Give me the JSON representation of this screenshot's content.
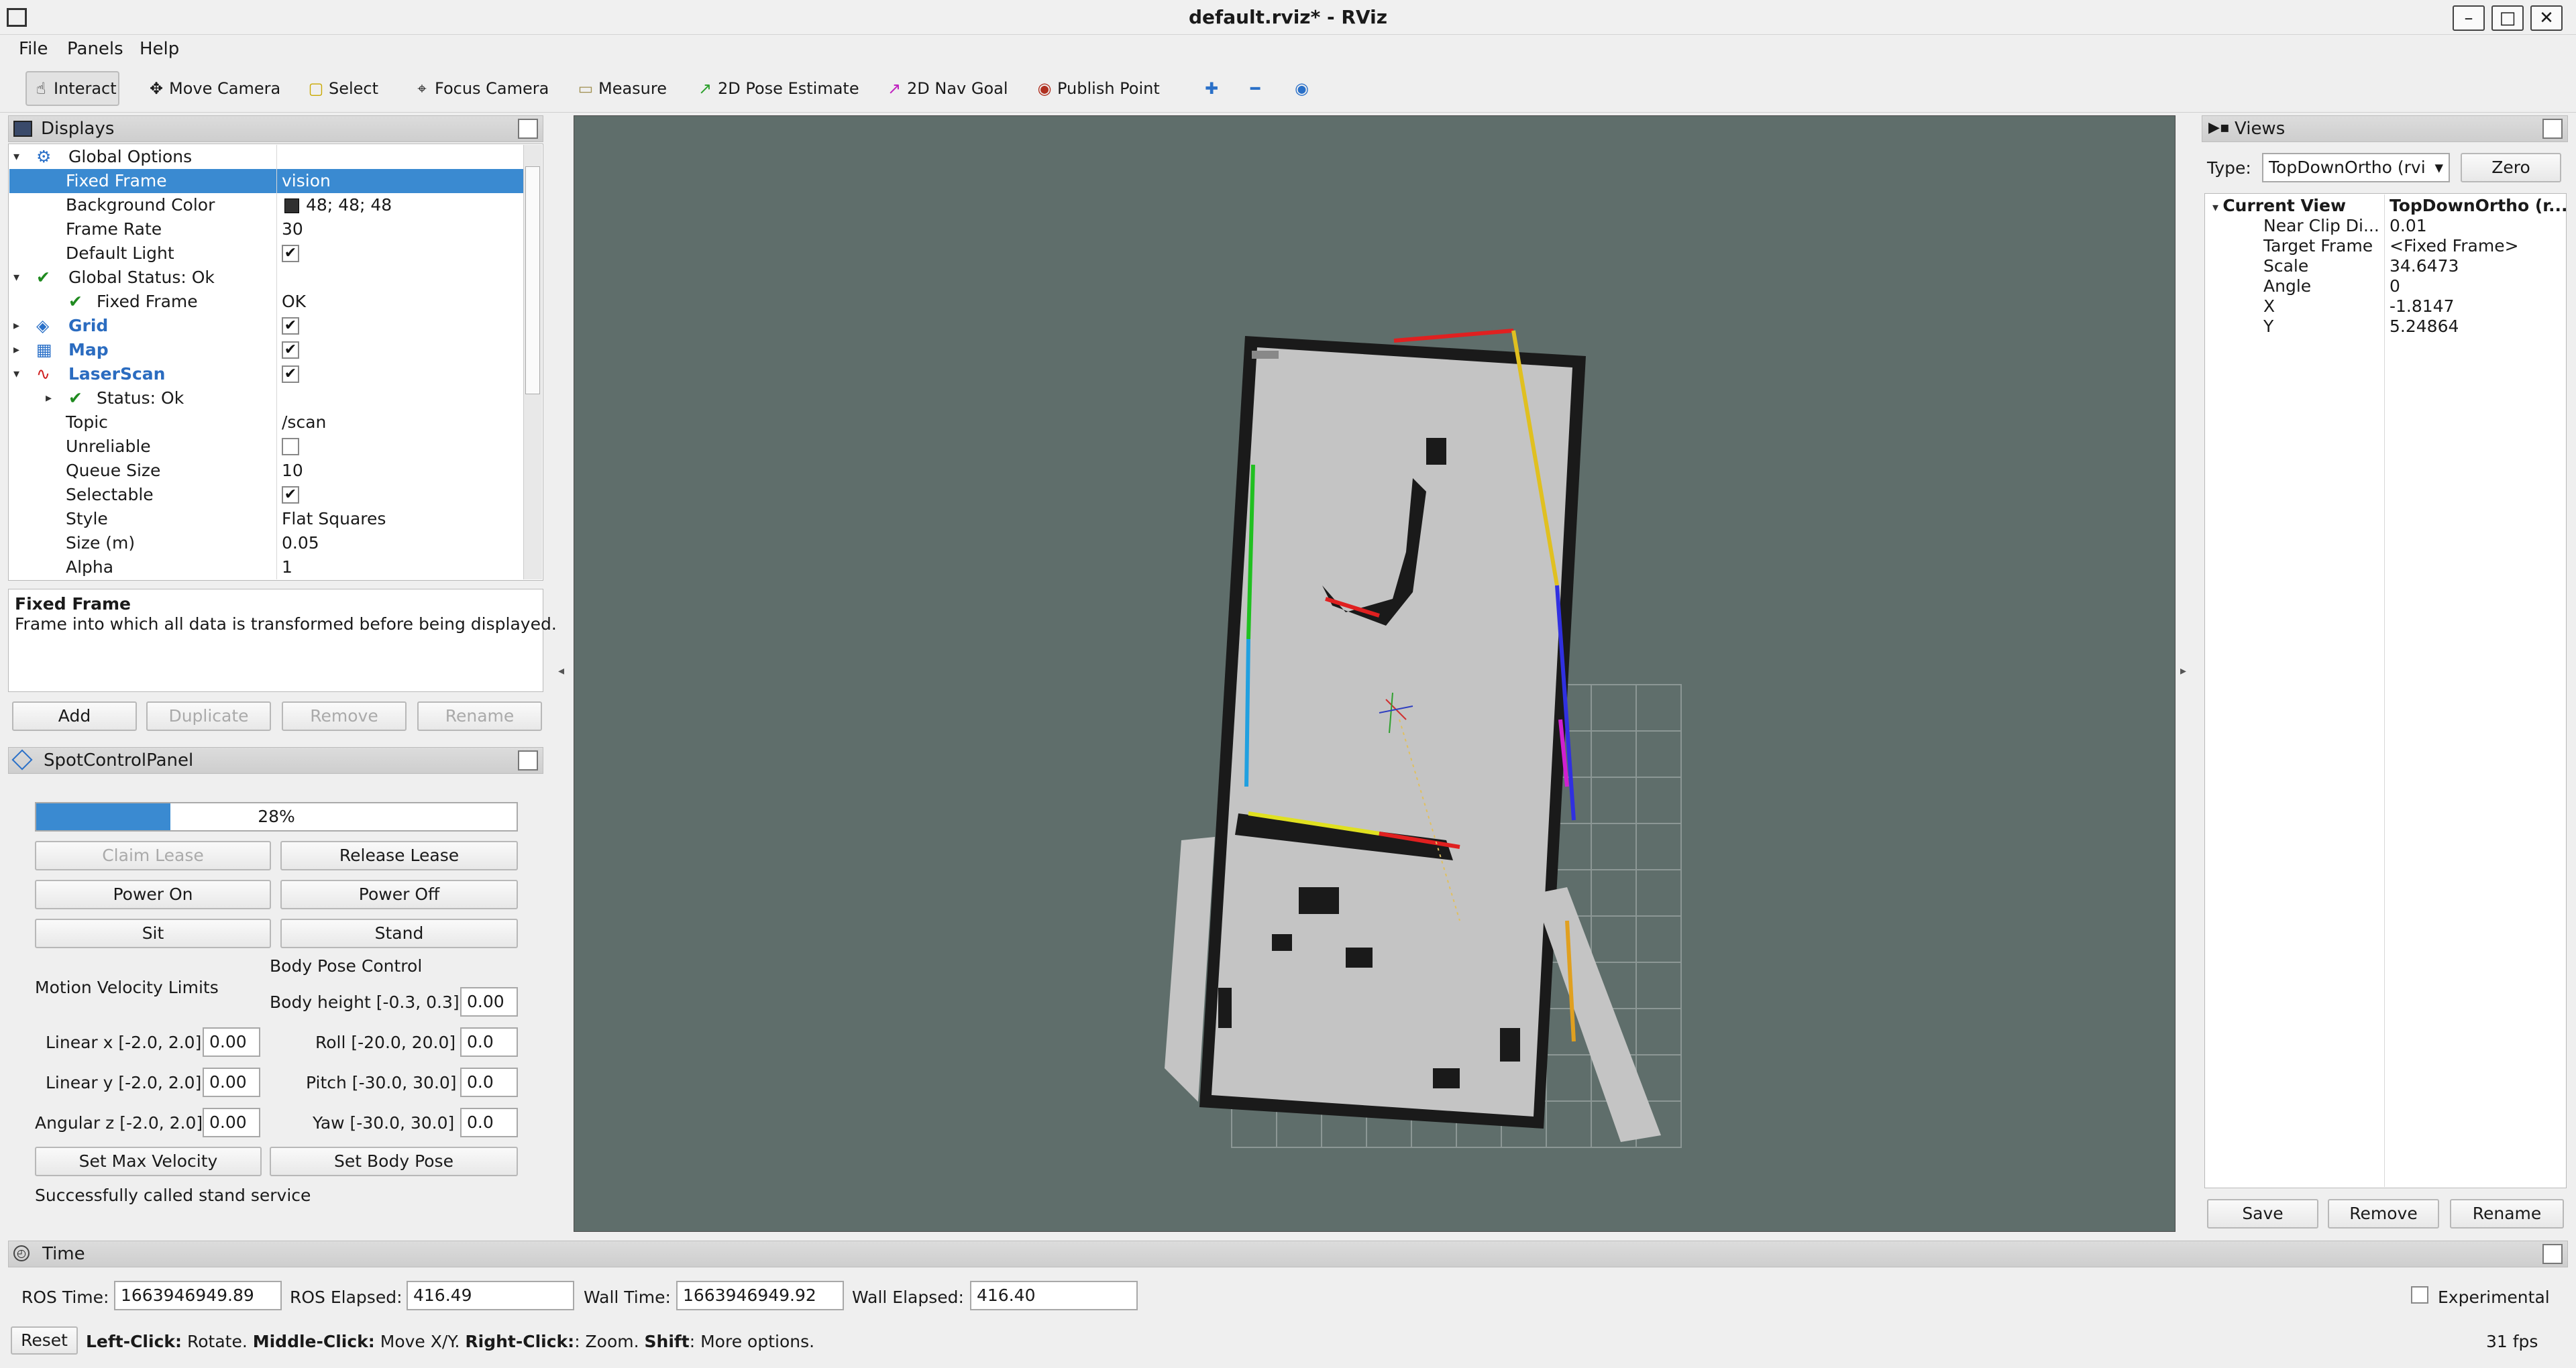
{
  "window": {
    "title": "default.rviz* - RViz",
    "min_glyph": "–",
    "max_glyph": "□",
    "close_glyph": "✕"
  },
  "menu": [
    "File",
    "Panels",
    "Help"
  ],
  "toolbar": [
    {
      "label": "Interact",
      "icon": "hand-icon",
      "glyph": "☝"
    },
    {
      "label": "Move Camera",
      "icon": "move-camera-icon",
      "glyph": "✥"
    },
    {
      "label": "Select",
      "icon": "select-icon",
      "glyph": "▢"
    },
    {
      "label": "Focus Camera",
      "icon": "focus-camera-icon",
      "glyph": "⌖"
    },
    {
      "label": "Measure",
      "icon": "ruler-icon",
      "glyph": "▭"
    },
    {
      "label": "2D Pose Estimate",
      "icon": "pose-estimate-icon",
      "glyph": "↗"
    },
    {
      "label": "2D Nav Goal",
      "icon": "nav-goal-icon",
      "glyph": "↗"
    },
    {
      "label": "Publish Point",
      "icon": "map-pin-icon",
      "glyph": "◉"
    }
  ],
  "toolbar_extra": {
    "plus": "✚",
    "minus": "━",
    "eye": "◉"
  },
  "displays": {
    "title": "Displays",
    "rows": [
      {
        "label": "Global Options",
        "value": "",
        "indent": 0,
        "expand": "▾",
        "icon": "⚙"
      },
      {
        "label": "Fixed Frame",
        "value": "vision",
        "indent": 1,
        "selected": true
      },
      {
        "label": "Background Color",
        "value": "48; 48; 48",
        "indent": 1,
        "swatch": "#303030"
      },
      {
        "label": "Frame Rate",
        "value": "30",
        "indent": 1
      },
      {
        "label": "Default Light",
        "value": "✔",
        "indent": 1,
        "check": true
      },
      {
        "label": "Global Status: Ok",
        "value": "",
        "indent": 0,
        "expand": "▾",
        "icon": "✔",
        "iconColor": "#1f8a1f"
      },
      {
        "label": "Fixed Frame",
        "value": "OK",
        "indent": 1,
        "icon": "✔",
        "iconColor": "#1f8a1f"
      },
      {
        "label": "Grid",
        "value": "✔",
        "indent": 0,
        "expand": "▸",
        "icon": "◈",
        "link": true,
        "check": true
      },
      {
        "label": "Map",
        "value": "✔",
        "indent": 0,
        "expand": "▸",
        "icon": "▦",
        "link": true,
        "check": true
      },
      {
        "label": "LaserScan",
        "value": "✔",
        "indent": 0,
        "expand": "▾",
        "icon": "∿",
        "iconColor": "#d02020",
        "link": true,
        "check": true
      },
      {
        "label": "Status: Ok",
        "value": "",
        "indent": 1,
        "expand": "▸",
        "icon": "✔",
        "iconColor": "#1f8a1f"
      },
      {
        "label": "Topic",
        "value": "/scan",
        "indent": 1
      },
      {
        "label": "Unreliable",
        "value": "",
        "indent": 1,
        "check": true
      },
      {
        "label": "Queue Size",
        "value": "10",
        "indent": 1
      },
      {
        "label": "Selectable",
        "value": "✔",
        "indent": 1,
        "check": true
      },
      {
        "label": "Style",
        "value": "Flat Squares",
        "indent": 1
      },
      {
        "label": "Size (m)",
        "value": "0.05",
        "indent": 1
      },
      {
        "label": "Alpha",
        "value": "1",
        "indent": 1
      }
    ],
    "desc_title": "Fixed Frame",
    "desc_text": "Frame into which all data is transformed before being displayed.",
    "buttons": {
      "add": "Add",
      "duplicate": "Duplicate",
      "remove": "Remove",
      "rename": "Rename"
    }
  },
  "spot": {
    "title": "SpotControlPanel",
    "progress_text": "28%",
    "progress": 0.28,
    "claim": "Claim Lease",
    "release": "Release Lease",
    "power_on": "Power On",
    "power_off": "Power Off",
    "sit": "Sit",
    "stand": "Stand",
    "body_pose_label": "Body Pose Control",
    "motion_label": "Motion Velocity Limits",
    "body_height_label": "Body height [-0.3, 0.3]",
    "body_height": "0.00",
    "linear_x_label": "Linear x [-2.0, 2.0]",
    "linear_x": "0.00",
    "roll_label": "Roll [-20.0, 20.0]",
    "roll": "0.0",
    "linear_y_label": "Linear y [-2.0, 2.0]",
    "linear_y": "0.00",
    "pitch_label": "Pitch [-30.0, 30.0]",
    "pitch": "0.0",
    "angular_z_label": "Angular z [-2.0, 2.0]",
    "angular_z": "0.00",
    "yaw_label": "Yaw [-30.0, 30.0]",
    "yaw": "0.0",
    "set_max": "Set Max Velocity",
    "set_body": "Set Body Pose",
    "status": "Successfully called stand service"
  },
  "views": {
    "title": "Views",
    "type_label": "Type:",
    "type_value": "TopDownOrtho (rvi",
    "zero": "Zero",
    "current_view": "Current View",
    "current_view_value": "TopDownOrtho (r...",
    "props": [
      {
        "label": "Near Clip Di...",
        "value": "0.01"
      },
      {
        "label": "Target Frame",
        "value": "<Fixed Frame>"
      },
      {
        "label": "Scale",
        "value": "34.6473"
      },
      {
        "label": "Angle",
        "value": "0"
      },
      {
        "label": "X",
        "value": "-1.8147"
      },
      {
        "label": "Y",
        "value": "5.24864"
      }
    ],
    "save": "Save",
    "remove": "Remove",
    "rename": "Rename"
  },
  "time": {
    "title": "Time",
    "ros_time_label": "ROS Time:",
    "ros_time": "1663946949.89",
    "ros_elapsed_label": "ROS Elapsed:",
    "ros_elapsed": "416.49",
    "wall_time_label": "Wall Time:",
    "wall_time": "1663946949.92",
    "wall_elapsed_label": "Wall Elapsed:",
    "wall_elapsed": "416.40",
    "experimental": "Experimental"
  },
  "status": {
    "reset": "Reset",
    "left_click": "Left-Click:",
    "left_click_text": " Rotate. ",
    "middle_click": "Middle-Click:",
    "middle_click_text": " Move X/Y. ",
    "right_click": "Right-Click:",
    "right_click_text": ": Zoom. ",
    "shift": "Shift",
    "shift_text": ": More options.",
    "fps": "31 fps"
  },
  "colors": {
    "selection": "#3a8ad1",
    "viewport_bg": "#5f6e6b",
    "map_free": "#c4c4c4",
    "progress": "#3a8ad1"
  }
}
